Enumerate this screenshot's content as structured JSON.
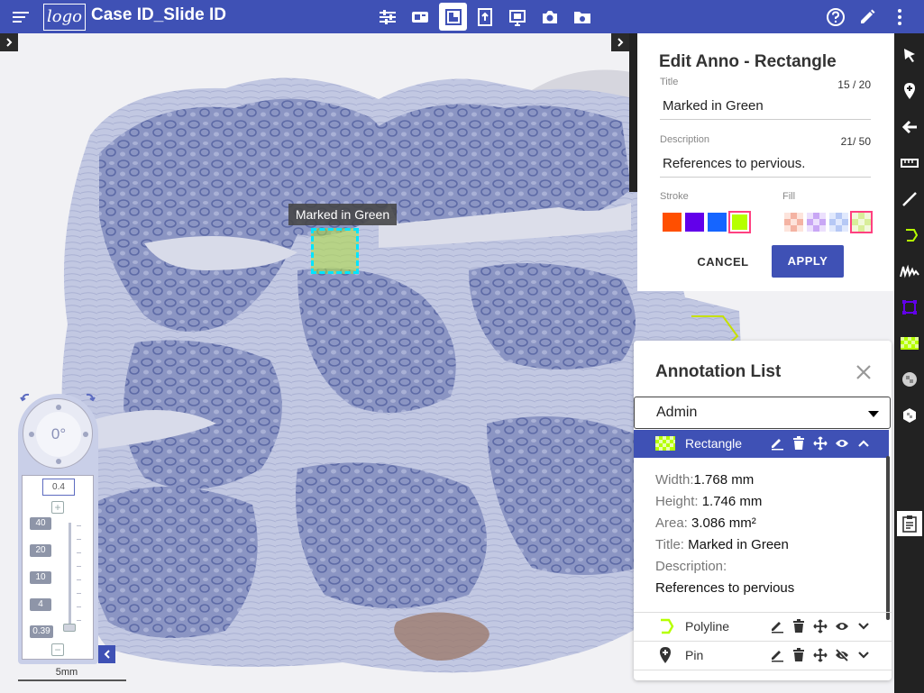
{
  "topbar": {
    "logo_text": "logo",
    "title": "Case ID_Slide ID",
    "tools": [
      "settings-sliders",
      "slide-label",
      "layout-single",
      "annotation-upload",
      "fullscreen",
      "camera",
      "folder-camera"
    ],
    "active_tool": "layout-single",
    "right": [
      "help",
      "edit",
      "more"
    ]
  },
  "viewer": {
    "annotation_label": "Marked in Green"
  },
  "edit_anno": {
    "heading": "Edit Anno - Rectangle",
    "title_label": "Title",
    "title_count": "15 / 20",
    "title_value": "Marked in Green",
    "desc_label": "Description",
    "desc_count": "21/ 50",
    "desc_value": "References to pervious.",
    "stroke_label": "Stroke",
    "fill_label": "Fill",
    "stroke_colors": [
      "#ff4f00",
      "#6200ea",
      "#1565ff",
      "#b6ff00"
    ],
    "selected_stroke": "#b6ff00",
    "fill_colors": [
      "#f4b3a3",
      "#c9a7f5",
      "#b6c8f5",
      "#d9ee9a"
    ],
    "cancel_label": "CANCEL",
    "apply_label": "APPLY",
    "accent": "#3f51b5",
    "selection_outline": "#ff4081"
  },
  "annotation_list": {
    "heading": "Annotation List",
    "filter_value": "Admin",
    "items": [
      {
        "label": "Rectangle",
        "icon": "rectangle-checker-icon",
        "visible": true,
        "expanded": true
      },
      {
        "label": "Polyline",
        "icon": "polyline-icon",
        "visible": true,
        "expanded": false
      },
      {
        "label": "Pin",
        "icon": "pin-icon",
        "visible": false,
        "expanded": false
      }
    ],
    "details": {
      "width_key": "Width:",
      "width_val": "1.768 mm",
      "height_key": "Height: ",
      "height_val": "1.746 mm",
      "area_key": "Area: ",
      "area_val": "3.086 mm²",
      "title_key": "Title: ",
      "title_val": "Marked in Green",
      "desc_key": "Description:",
      "desc_val": "References to  pervious"
    }
  },
  "zoom": {
    "rotation": "0°",
    "current": "0.4",
    "levels": [
      "40",
      "20",
      "10",
      "4",
      "0.39"
    ],
    "plus": "+",
    "minus": "−",
    "scale_label": "5mm"
  },
  "right_tools": [
    "pointer",
    "pin",
    "back-arrow",
    "ruler",
    "line",
    "polygon",
    "freehand",
    "transform-square",
    "checker-fill",
    "hexagon-checker",
    "hexagon",
    "report"
  ]
}
